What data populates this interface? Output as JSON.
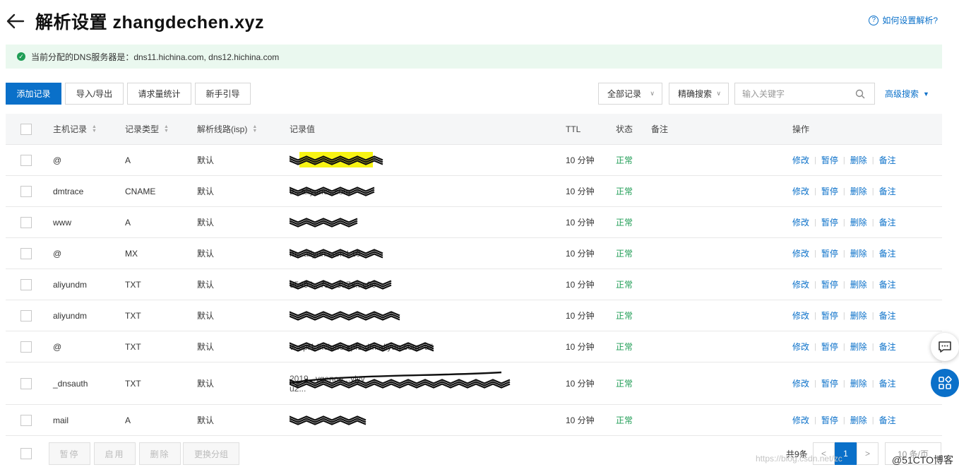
{
  "header": {
    "title": "解析设置 zhangdechen.xyz",
    "help_link": "如何设置解析?"
  },
  "banner": {
    "text": "当前分配的DNS服务器是：dns11.hichina.com, dns12.hichina.com"
  },
  "toolbar": {
    "add_record": "添加记录",
    "import_export": "导入/导出",
    "request_stats": "请求量统计",
    "beginner_guide": "新手引导",
    "record_filter": "全部记录",
    "search_mode": "精确搜索",
    "search_placeholder": "输入关键字",
    "advanced_search": "高级搜索"
  },
  "table": {
    "columns": {
      "host": "主机记录",
      "type": "记录类型",
      "line": "解析线路(isp)",
      "value": "记录值",
      "ttl": "TTL",
      "status": "状态",
      "remark": "备注",
      "actions": "操作"
    },
    "actions": {
      "edit": "修改",
      "pause": "暂停",
      "delete": "删除",
      "remark": "备注"
    },
    "rows": [
      {
        "host": "@",
        "type": "A",
        "line": "默认",
        "value": "",
        "ttl": "10 分钟",
        "status": "正常",
        "remark": ""
      },
      {
        "host": "dmtrace",
        "type": "CNAME",
        "line": "默认",
        "value": "tr...aliyuncs.com",
        "ttl": "10 分钟",
        "status": "正常",
        "remark": ""
      },
      {
        "host": "www",
        "type": "A",
        "line": "默认",
        "value": "",
        "ttl": "10 分钟",
        "status": "正常",
        "remark": ""
      },
      {
        "host": "@",
        "type": "MX",
        "line": "默认",
        "value": "m...aliyun.com | 10",
        "ttl": "10 分钟",
        "status": "正常",
        "remark": ""
      },
      {
        "host": "aliyundm",
        "type": "TXT",
        "line": "默认",
        "value": "95493...72...3374...c0c",
        "ttl": "10 分钟",
        "status": "正常",
        "remark": ""
      },
      {
        "host": "aliyundm",
        "type": "TXT",
        "line": "默认",
        "value": "",
        "ttl": "10 分钟",
        "status": "正常",
        "remark": ""
      },
      {
        "host": "@",
        "type": "TXT",
        "line": "默认",
        "value": "v=spf1 include:spf1.dm.aliyun.com -all",
        "ttl": "10 分钟",
        "status": "正常",
        "remark": ""
      },
      {
        "host": "_dnsauth",
        "type": "TXT",
        "line": "默认",
        "value": "2019...ygenoo...yjyv",
        "value2": "u2...",
        "ttl": "10 分钟",
        "status": "正常",
        "remark": ""
      },
      {
        "host": "mail",
        "type": "A",
        "line": "默认",
        "value": "",
        "ttl": "10 分钟",
        "status": "正常",
        "remark": ""
      }
    ]
  },
  "footer": {
    "pause": "暂停",
    "enable": "启用",
    "delete": "删除",
    "change_group": "更换分组",
    "total": "共9条",
    "prev": "<",
    "page": "1",
    "next": ">",
    "page_size": "10 条/页"
  },
  "watermark": "https://blog.csdn.net/zc",
  "watermark2": "@51CTO博客"
}
